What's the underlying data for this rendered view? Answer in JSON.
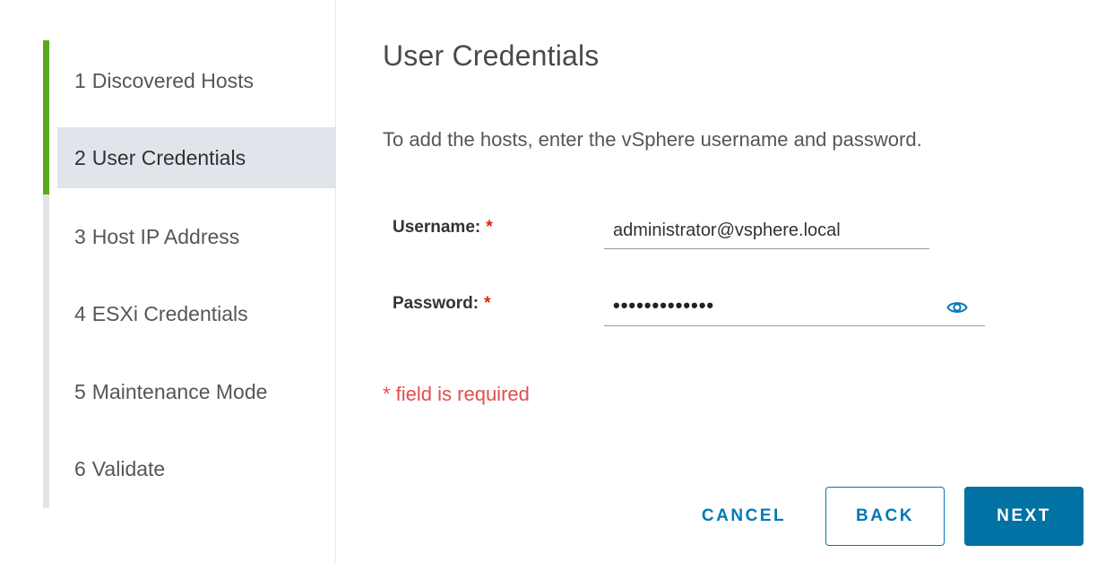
{
  "wizard": {
    "steps": [
      {
        "num": "1",
        "label": "Discovered Hosts"
      },
      {
        "num": "2",
        "label": "User Credentials"
      },
      {
        "num": "3",
        "label": "Host IP Address"
      },
      {
        "num": "4",
        "label": "ESXi Credentials"
      },
      {
        "num": "5",
        "label": "Maintenance Mode"
      },
      {
        "num": "6",
        "label": "Validate"
      }
    ],
    "active_step": 2
  },
  "page": {
    "title": "User Credentials",
    "description": "To add the hosts, enter the vSphere username and password."
  },
  "form": {
    "username": {
      "label": "Username:",
      "required_marker": "*",
      "value": "administrator@vsphere.local"
    },
    "password": {
      "label": "Password:",
      "required_marker": "*",
      "masked_value": "•••••••••••••",
      "reveal_icon": "eye-icon"
    },
    "required_note": "* field is required"
  },
  "buttons": {
    "cancel": "CANCEL",
    "back": "BACK",
    "next": "NEXT"
  },
  "colors": {
    "progress": "#5aaa1c",
    "primary": "#0072a3",
    "link": "#0079b8",
    "error": "#e04e4e",
    "active_step_bg": "#dfe5ea"
  }
}
